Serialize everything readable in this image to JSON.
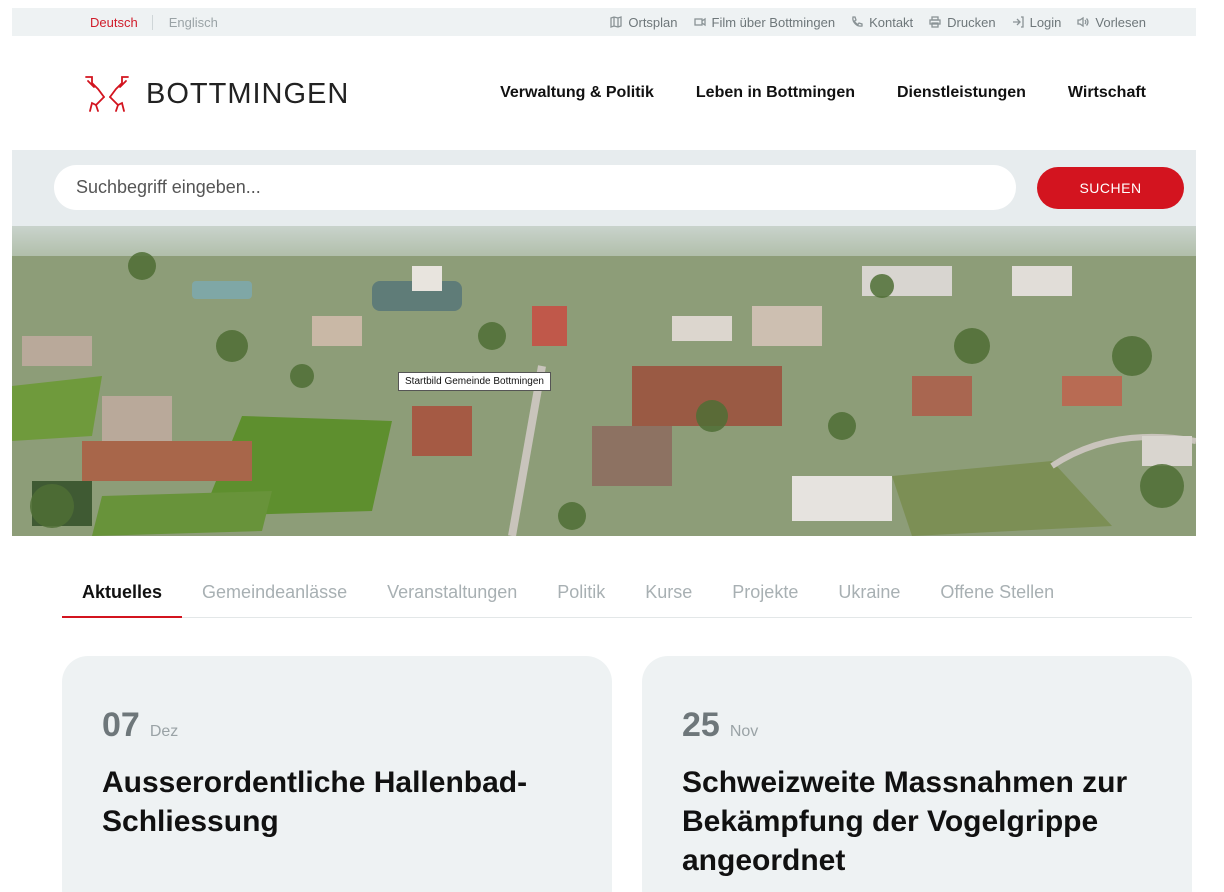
{
  "topbar": {
    "languages": {
      "german": "Deutsch",
      "english": "Englisch"
    },
    "utilities": [
      {
        "icon": "map-icon",
        "label": "Ortsplan"
      },
      {
        "icon": "video-icon",
        "label": "Film über Bottmingen"
      },
      {
        "icon": "phone-icon",
        "label": "Kontakt"
      },
      {
        "icon": "printer-icon",
        "label": "Drucken"
      },
      {
        "icon": "login-icon",
        "label": "Login"
      },
      {
        "icon": "speaker-icon",
        "label": "Vorlesen"
      }
    ]
  },
  "header": {
    "logo_text": "BOTTMINGEN",
    "nav": [
      "Verwaltung & Politik",
      "Leben in Bottmingen",
      "Dienstleistungen",
      "Wirtschaft"
    ]
  },
  "search": {
    "placeholder": "Suchbegriff eingeben...",
    "button_label": "SUCHEN"
  },
  "hero": {
    "tooltip": "Startbild Gemeinde Bottmingen"
  },
  "tabs": [
    "Aktuelles",
    "Gemeindeanlässe",
    "Veranstaltungen",
    "Politik",
    "Kurse",
    "Projekte",
    "Ukraine",
    "Offene Stellen"
  ],
  "active_tab": "Aktuelles",
  "news": [
    {
      "day": "07",
      "month": "Dez",
      "title": "Ausserordentliche Hallenbad-Schliessung"
    },
    {
      "day": "25",
      "month": "Nov",
      "title": "Schweizweite Massnahmen zur Bekämpfung der Vogelgrippe angeordnet"
    }
  ],
  "colors": {
    "accent": "#d3141f",
    "band": "#e7ecee",
    "card": "#eef2f3"
  }
}
